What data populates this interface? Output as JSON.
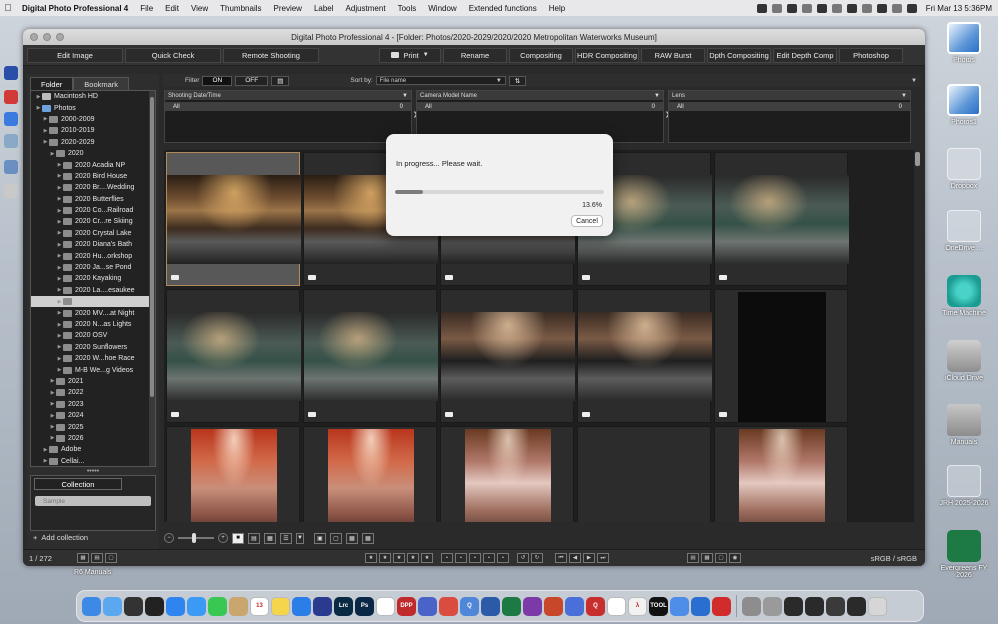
{
  "menubar": {
    "app_name": "Digital Photo Professional 4",
    "items": [
      "File",
      "Edit",
      "View",
      "Thumbnails",
      "Preview",
      "Label",
      "Adjustment",
      "Tools",
      "Window",
      "Extended functions",
      "Help"
    ],
    "clock": "Fri Mar 13  5:36PM"
  },
  "desktop": {
    "icons": [
      {
        "label": "Photos",
        "icon": "photos-folder-icon"
      },
      {
        "label": "Photos1",
        "icon": "photos-folder-icon"
      },
      {
        "label": "Dropbox",
        "icon": "dropbox-icon"
      },
      {
        "label": "OneDrive ...",
        "icon": "onedrive-icon"
      },
      {
        "label": "Time Machine",
        "icon": "time-machine-icon"
      },
      {
        "label": "iCloud Drive",
        "icon": "drive-icon"
      },
      {
        "label": "Manuals",
        "icon": "folder-icon"
      },
      {
        "label": "JRH 2025-2026",
        "icon": "document-icon"
      },
      {
        "label": "Evergreens FY 2026",
        "icon": "excel-icon"
      }
    ],
    "r6_label": "R6 Manuals"
  },
  "window": {
    "title": "Digital Photo Professional 4 - [Folder: Photos/2020-2029/2020/2020 Metropolitan Waterworks Museum]"
  },
  "toolbar": {
    "edit_image": "Edit Image",
    "quick_check": "Quick Check",
    "remote_shooting": "Remote Shooting",
    "print": "Print",
    "rename": "Rename",
    "compositing": "Compositing",
    "hdr_compositing": "HDR Compositing",
    "raw_burst": "RAW Burst",
    "depth_compositing": "Dpth Compositing",
    "edit_depth_comp": "Edit Depth Comp",
    "photoshop": "Photoshop"
  },
  "folder_panel": {
    "tab_folder": "Folder",
    "tab_bookmark": "Bookmark",
    "tree": [
      {
        "label": "Macintosh HD",
        "indent": 0,
        "icon": "hd"
      },
      {
        "label": "Photos",
        "indent": 0,
        "icon": "photos"
      },
      {
        "label": "2000-2009",
        "indent": 1
      },
      {
        "label": "2010-2019",
        "indent": 1
      },
      {
        "label": "2020-2029",
        "indent": 1
      },
      {
        "label": "2020",
        "indent": 2
      },
      {
        "label": "2020 Acadia NP",
        "indent": 3
      },
      {
        "label": "2020 Bird House",
        "indent": 3
      },
      {
        "label": "2020 Br....Wedding",
        "indent": 3
      },
      {
        "label": "2020 Butterflies",
        "indent": 3
      },
      {
        "label": "2020 Co...Railroad",
        "indent": 3
      },
      {
        "label": "2020 Cr...re Skiing",
        "indent": 3
      },
      {
        "label": "2020 Crystal Lake",
        "indent": 3
      },
      {
        "label": "2020 Diana's Bath",
        "indent": 3
      },
      {
        "label": "2020 Hu...orkshop",
        "indent": 3
      },
      {
        "label": "2020 Ja...se Pond",
        "indent": 3
      },
      {
        "label": "2020 Kayaking",
        "indent": 3
      },
      {
        "label": "2020 La....esaukee",
        "indent": 3
      },
      {
        "label": "",
        "indent": 3,
        "selected": true
      },
      {
        "label": "2020 MV....at Night",
        "indent": 3
      },
      {
        "label": "2020 N...as Lights",
        "indent": 3
      },
      {
        "label": "2020 OSV",
        "indent": 3
      },
      {
        "label": "2020 Sunflowers",
        "indent": 3
      },
      {
        "label": "2020 W...hoe Race",
        "indent": 3
      },
      {
        "label": "M-B We...g Videos",
        "indent": 3
      },
      {
        "label": "2021",
        "indent": 2
      },
      {
        "label": "2022",
        "indent": 2
      },
      {
        "label": "2023",
        "indent": 2
      },
      {
        "label": "2024",
        "indent": 2
      },
      {
        "label": "2025",
        "indent": 2
      },
      {
        "label": "2026",
        "indent": 2
      },
      {
        "label": "Adobe",
        "indent": 1
      },
      {
        "label": "Cellai...",
        "indent": 1
      }
    ]
  },
  "collection_panel": {
    "tab": "Collection",
    "item": "Sample",
    "add": "Add collection"
  },
  "filter_bar": {
    "label": "Filter",
    "on": "ON",
    "off": "OFF",
    "sort_label": "Sort by:",
    "sort_value": "File name"
  },
  "filter_panels": [
    {
      "header": "Shooting Date/Time",
      "row_label": "All",
      "row_count": "0"
    },
    {
      "header": "Camera Model Name",
      "row_label": "All",
      "row_count": "0"
    },
    {
      "header": "Lens",
      "row_label": "All",
      "row_count": "0"
    }
  ],
  "dialog": {
    "message": "In progress... Please wait.",
    "percent_text": "13.6%",
    "progress": 0.136,
    "cancel": "Cancel"
  },
  "statusbar": {
    "count": "1 / 272",
    "color_space": "sRGB / sRGB"
  },
  "dock": {
    "icons": [
      {
        "name": "finder-icon",
        "color": "#3d8ae6",
        "glyph": ""
      },
      {
        "name": "icloud-icon",
        "color": "#5aa9f0",
        "glyph": ""
      },
      {
        "name": "screenshot-icon",
        "color": "#333333",
        "glyph": ""
      },
      {
        "name": "mission-control-icon",
        "color": "#222222",
        "glyph": ""
      },
      {
        "name": "app-store-icon",
        "color": "#2f84f0",
        "glyph": ""
      },
      {
        "name": "mail-icon",
        "color": "#3b9af3",
        "glyph": ""
      },
      {
        "name": "messages-icon",
        "color": "#39c852",
        "glyph": ""
      },
      {
        "name": "contacts-icon",
        "color": "#c9a66e",
        "glyph": ""
      },
      {
        "name": "calendar-icon",
        "color": "#ffffff",
        "glyph": "13"
      },
      {
        "name": "notes-icon",
        "color": "#f5d64a",
        "glyph": ""
      },
      {
        "name": "safari-icon",
        "color": "#2b7de8",
        "glyph": ""
      },
      {
        "name": "camera-app-icon",
        "color": "#2a3a8f",
        "glyph": ""
      },
      {
        "name": "lightroom-icon",
        "color": "#0a2a44",
        "glyph": "Lrc"
      },
      {
        "name": "photoshop-icon",
        "color": "#0b2746",
        "glyph": "Ps"
      },
      {
        "name": "photos-app-icon",
        "color": "#ffffff",
        "glyph": ""
      },
      {
        "name": "dpp-icon",
        "color": "#c02a2a",
        "glyph": "DPP"
      },
      {
        "name": "canon-app-icon",
        "color": "#4a63c8",
        "glyph": ""
      },
      {
        "name": "pdf-icon",
        "color": "#d94c3f",
        "glyph": ""
      },
      {
        "name": "quicken-icon",
        "color": "#4f86d8",
        "glyph": "Q"
      },
      {
        "name": "word-icon",
        "color": "#2b5aa9",
        "glyph": ""
      },
      {
        "name": "excel-icon",
        "color": "#1d7a45",
        "glyph": ""
      },
      {
        "name": "onenote-icon",
        "color": "#7b3aa8",
        "glyph": ""
      },
      {
        "name": "powerpoint-icon",
        "color": "#c8462a",
        "glyph": ""
      },
      {
        "name": "translate-icon",
        "color": "#4a6fd8",
        "glyph": ""
      },
      {
        "name": "quora-icon",
        "color": "#c92e2e",
        "glyph": "Q"
      },
      {
        "name": "app-icon-a",
        "color": "#ffffff",
        "glyph": ""
      },
      {
        "name": "lambda-icon",
        "color": "#f2f2f2",
        "glyph": "λ"
      },
      {
        "name": "tool-icon",
        "color": "#111111",
        "glyph": "TOOL"
      },
      {
        "name": "weather-icon",
        "color": "#4f8ee8",
        "glyph": ""
      },
      {
        "name": "windows-icon",
        "color": "#2a6fd0",
        "glyph": ""
      },
      {
        "name": "red-app-icon",
        "color": "#d22b2b",
        "glyph": ""
      },
      {
        "name": "downloads-folder-icon",
        "color": "#8d8d8d",
        "glyph": ""
      },
      {
        "name": "folder-dock-icon",
        "color": "#9a9a9a",
        "glyph": ""
      },
      {
        "name": "window-thumb-icon",
        "color": "#2a2a2a",
        "glyph": ""
      },
      {
        "name": "window-thumb-icon-2",
        "color": "#2a2a2a",
        "glyph": ""
      },
      {
        "name": "window-thumb-icon-3",
        "color": "#3a3a3a",
        "glyph": ""
      },
      {
        "name": "window-thumb-icon-4",
        "color": "#2a2a2a",
        "glyph": ""
      },
      {
        "name": "trash-icon",
        "color": "#d6d6d6",
        "glyph": ""
      }
    ]
  },
  "thumbnails": [
    {
      "style": "img-machine",
      "selected": true
    },
    {
      "style": "img-machine"
    },
    {
      "style": "img-machine"
    },
    {
      "style": "img-green"
    },
    {
      "style": "img-green"
    },
    {
      "style": "img-green"
    },
    {
      "style": "img-green"
    },
    {
      "style": "img-hall"
    },
    {
      "style": "img-hall"
    },
    {
      "style": "dark"
    },
    {
      "style": "img-red"
    },
    {
      "style": "img-red"
    },
    {
      "style": "img-copper"
    },
    {
      "style": "empty"
    },
    {
      "style": "img-copper"
    }
  ]
}
